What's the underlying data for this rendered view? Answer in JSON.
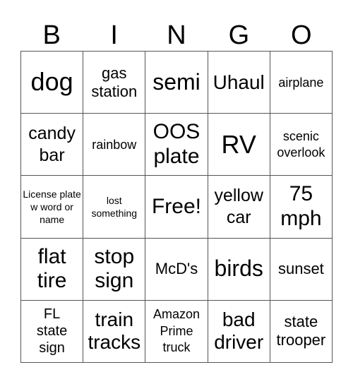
{
  "header": {
    "letters": [
      "B",
      "I",
      "N",
      "G",
      "O"
    ]
  },
  "cells": [
    [
      "dog",
      "gas station",
      "semi",
      "Uhaul",
      "airplane"
    ],
    [
      "candy bar",
      "rainbow",
      "OOS plate",
      "RV",
      "scenic overlook"
    ],
    [
      "License plate w word or name",
      "lost something",
      "Free!",
      "yellow car",
      "75 mph"
    ],
    [
      "flat tire",
      "stop sign",
      "McD's",
      "birds",
      "sunset"
    ],
    [
      "FL state sign",
      "train tracks",
      "Amazon Prime truck",
      "bad driver",
      "state trooper"
    ]
  ]
}
